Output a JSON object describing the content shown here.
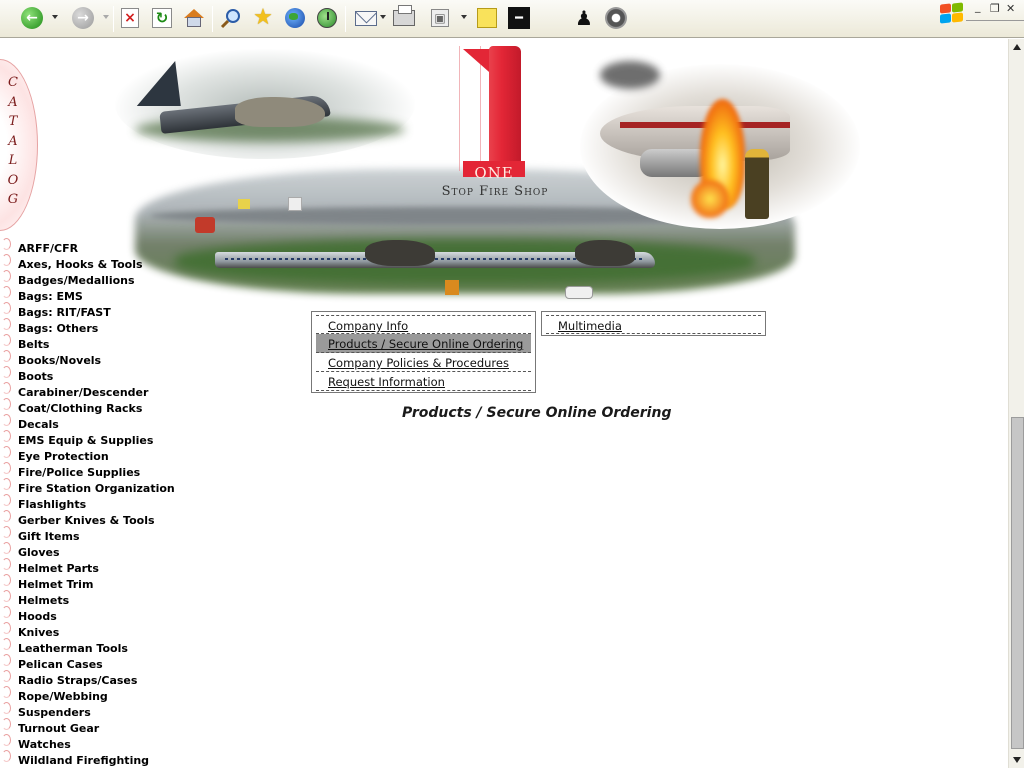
{
  "toolbar": {
    "buttons": [
      {
        "name": "back",
        "icon": "back-arrow-icon"
      },
      {
        "name": "forward",
        "icon": "forward-arrow-icon"
      },
      {
        "name": "stop",
        "icon": "stop-icon"
      },
      {
        "name": "refresh",
        "icon": "refresh-icon"
      },
      {
        "name": "home",
        "icon": "home-icon"
      },
      {
        "name": "search",
        "icon": "search-icon"
      },
      {
        "name": "favorites",
        "icon": "star-icon"
      },
      {
        "name": "media",
        "icon": "globe-icon"
      },
      {
        "name": "history",
        "icon": "history-icon"
      },
      {
        "name": "mail",
        "icon": "mail-icon"
      },
      {
        "name": "print",
        "icon": "printer-icon"
      },
      {
        "name": "size",
        "icon": "fit-window-icon"
      },
      {
        "name": "notes",
        "icon": "sticky-note-icon"
      },
      {
        "name": "tool",
        "icon": "tool-icon"
      },
      {
        "name": "messenger",
        "icon": "messenger-person-icon"
      },
      {
        "name": "settings",
        "icon": "gear-icon"
      }
    ]
  },
  "window": {
    "minimize_label": "_",
    "restore_label": "❐",
    "close_label": "✕"
  },
  "site": {
    "logo_word": "ONE",
    "tagline": "Stop Fire Shop",
    "catalog_label": [
      "C",
      "A",
      "T",
      "A",
      "L",
      "O",
      "G"
    ],
    "brand_color": "#e32636"
  },
  "catalog": {
    "items": [
      "ARFF/CFR",
      "Axes, Hooks & Tools",
      "Badges/Medallions",
      "Bags: EMS",
      "Bags: RIT/FAST",
      "Bags: Others",
      "Belts",
      "Books/Novels",
      "Boots",
      "Carabiner/Descender",
      "Coat/Clothing Racks",
      "Decals",
      "EMS Equip & Supplies",
      "Eye Protection",
      "Fire/Police Supplies",
      "Fire Station Organization",
      "Flashlights",
      "Gerber Knives & Tools",
      "Gift Items",
      "Gloves",
      "Helmet Parts",
      "Helmet Trim",
      "Helmets",
      "Hoods",
      "Knives",
      "Leatherman Tools",
      "Pelican Cases",
      "Radio Straps/Cases",
      "Rope/Webbing",
      "Suspenders",
      "Turnout Gear",
      "Watches",
      "Wildland Firefighting"
    ]
  },
  "menu": {
    "left": [
      {
        "label": "Company Info",
        "active": false
      },
      {
        "label": "Products / Secure Online Ordering",
        "active": true
      },
      {
        "label": "Company Policies & Procedures",
        "active": false
      },
      {
        "label": "Request Information",
        "active": false
      }
    ],
    "right": [
      {
        "label": "Multimedia",
        "active": false
      }
    ]
  },
  "main": {
    "heading": "Products / Secure Online Ordering"
  }
}
